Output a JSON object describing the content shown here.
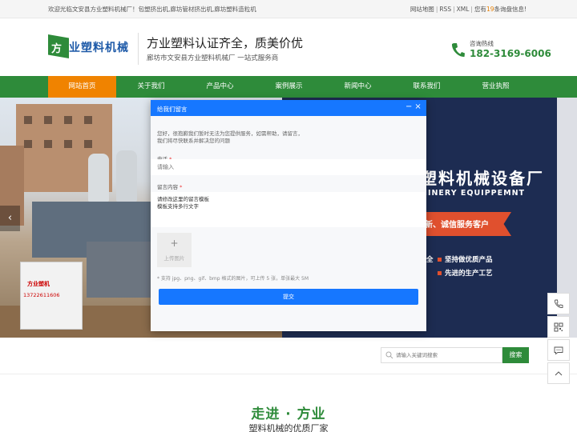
{
  "topbar": {
    "welcome": "欢迎光临文安县方业塑料机械厂！包塑挤出机,廊坊管材挤出机,廊坊塑料造粒机",
    "sitemap": "网站地图",
    "rss": "RSS",
    "xml": "XML",
    "inquiry_prefix": "您有",
    "inquiry_count": "19",
    "inquiry_suffix": "条询盘信息!"
  },
  "header": {
    "logo_mark": "方",
    "logo_name": "业塑料机械",
    "slogan": "方业塑料认证齐全，质美价优",
    "subslogan": "廊坊市文安县方业塑料机械厂 一站式服务商",
    "hotline_label": "咨询热线",
    "hotline_number": "182-3169-6006"
  },
  "nav": {
    "items": [
      {
        "label": "网站首页",
        "active": true
      },
      {
        "label": "关于我们"
      },
      {
        "label": "产品中心"
      },
      {
        "label": "案例展示"
      },
      {
        "label": "新闻中心"
      },
      {
        "label": "联系我们"
      },
      {
        "label": "营业执照"
      }
    ]
  },
  "banner": {
    "title_tail": "塑料机械设备厂",
    "en_tail": "HINERY EQUIPPEMNT",
    "ribbon": "新、诚信服务客户",
    "feature_partial": "全",
    "feature1": "坚持做优质产品",
    "feature2": "先进的生产工艺",
    "cabinet_brand": "方业塑机",
    "cabinet_tel": "13722611606",
    "prev_arrow": "‹",
    "next_arrow": "›"
  },
  "modal": {
    "title": "给我们留言",
    "minimize": "−",
    "close": "×",
    "intro_line1": "您好，很抱歉我们暂时无法为您提供服务，如需帮助，请留言，",
    "intro_line2": "我们将尽快联系并解决您的问题",
    "phone_label": "电话",
    "phone_placeholder": "请输入",
    "message_label": "留言内容",
    "message_value": "请修改这里的留言模板\n模板支持多行文字",
    "upload_plus": "+",
    "upload_label": "上传图片",
    "hint": "* 支持 jpg、png、gif、bmp 格式的图片，可上传 5 张，单张最大 5M",
    "submit": "提交"
  },
  "search": {
    "placeholder": "请输入关键词搜索",
    "button": "搜索"
  },
  "section": {
    "title": "走进 · 方业",
    "subtitle": "塑料机械的优质厂家"
  },
  "colors": {
    "brand_green": "#2e8b3a",
    "nav_active": "#f08300",
    "modal_blue": "#1677ff"
  },
  "icons": [
    "phone-icon",
    "qrcode-icon",
    "chat-icon",
    "back-to-top-icon",
    "search-icon",
    "hotline-icon"
  ]
}
